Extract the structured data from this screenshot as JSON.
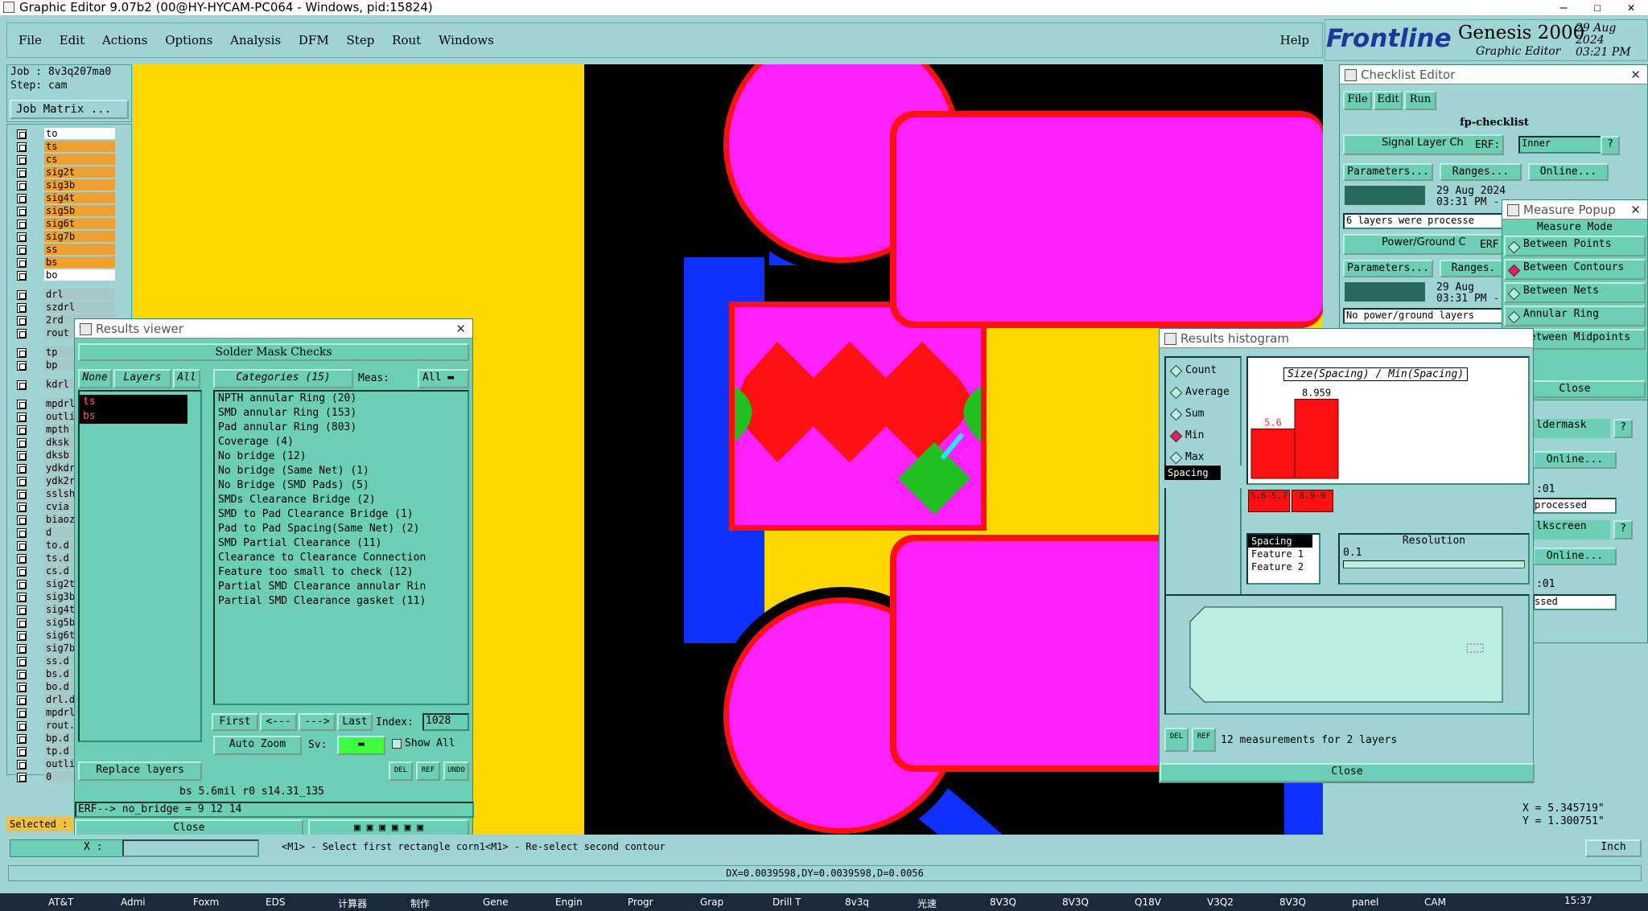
{
  "window": {
    "title": "Graphic Editor 9.07b2 (00@HY-HYCAM-PC064 - Windows, pid:15824)",
    "controls": [
      "—",
      "☐",
      "✕"
    ]
  },
  "menu": {
    "items": [
      "File",
      "Edit",
      "Actions",
      "Options",
      "Analysis",
      "DFM",
      "Step",
      "Rout",
      "Windows"
    ],
    "help": "Help"
  },
  "brand": {
    "logo": "Frontline",
    "product": "Genesis 2000",
    "subtitle": "Graphic Editor",
    "date": "29 Aug 2024",
    "time": "03:21 PM"
  },
  "job": {
    "job": "Job : 8v3q207ma0",
    "step": "Step: cam",
    "matrix": "Job Matrix ..."
  },
  "layers": [
    {
      "n": "to",
      "c": "#ffffff"
    },
    {
      "n": "ts",
      "c": "#f0a030"
    },
    {
      "n": "cs",
      "c": "#f0a030"
    },
    {
      "n": "sig2t",
      "c": "#f0a030"
    },
    {
      "n": "sig3b",
      "c": "#f0a030"
    },
    {
      "n": "sig4t",
      "c": "#f0a030"
    },
    {
      "n": "sig5b",
      "c": "#f0a030"
    },
    {
      "n": "sig6t",
      "c": "#f0a030"
    },
    {
      "n": "sig7b",
      "c": "#f0a030"
    },
    {
      "n": "ss",
      "c": "#f0a030"
    },
    {
      "n": "bs",
      "c": "#f0a030"
    },
    {
      "n": "bo",
      "c": "#ffffff"
    },
    {
      "n": "drl",
      "c": "#a8c8c8"
    },
    {
      "n": "szdrl",
      "c": "#a8c8c8"
    },
    {
      "n": "2rd",
      "c": "#a8c8c8"
    },
    {
      "n": "rout",
      "c": "#a8c8c8"
    },
    {
      "n": "tp",
      "c": "#a8c8c8"
    },
    {
      "n": "bp",
      "c": "#a8c8c8"
    },
    {
      "n": "kdrl",
      "c": "#a8c8c8"
    },
    {
      "n": "mpdrl",
      "c": "#a8c8c8"
    },
    {
      "n": "outlin",
      "c": "#a8c8c8"
    },
    {
      "n": "mpth",
      "c": "#a8c8c8"
    },
    {
      "n": "dksk",
      "c": "#a8c8c8"
    },
    {
      "n": "dksb",
      "c": "#a8c8c8"
    },
    {
      "n": "ydkdrl",
      "c": "#a8c8c8"
    },
    {
      "n": "ydk2rd",
      "c": "#a8c8c8"
    },
    {
      "n": "sslsh",
      "c": "#a8c8c8"
    },
    {
      "n": "cvia",
      "c": "#a8c8c8"
    },
    {
      "n": "biaozh",
      "c": "#a8c8c8"
    },
    {
      "n": "d",
      "c": "#a8c8c8"
    },
    {
      "n": "to.d",
      "c": "#a8c8c8"
    },
    {
      "n": "ts.d",
      "c": "#a8c8c8"
    },
    {
      "n": "cs.d",
      "c": "#a8c8c8"
    },
    {
      "n": "sig2t.",
      "c": "#a8c8c8"
    },
    {
      "n": "sig3b.",
      "c": "#a8c8c8"
    },
    {
      "n": "sig4t.",
      "c": "#a8c8c8"
    },
    {
      "n": "sig5b.",
      "c": "#a8c8c8"
    },
    {
      "n": "sig6t.",
      "c": "#a8c8c8"
    },
    {
      "n": "sig7b.",
      "c": "#a8c8c8"
    },
    {
      "n": "ss.d",
      "c": "#a8c8c8"
    },
    {
      "n": "bs.d",
      "c": "#a8c8c8"
    },
    {
      "n": "bo.d",
      "c": "#a8c8c8"
    },
    {
      "n": "drl.d",
      "c": "#a8c8c8"
    },
    {
      "n": "mpdrl.",
      "c": "#a8c8c8"
    },
    {
      "n": "rout.d",
      "c": "#a8c8c8"
    },
    {
      "n": "bp.d",
      "c": "#a8c8c8"
    },
    {
      "n": "tp.d",
      "c": "#a8c8c8"
    },
    {
      "n": "outlin",
      "c": "#a8c8c8"
    },
    {
      "n": "0",
      "c": "#a8c8c8"
    }
  ],
  "selected_label": "Selected :",
  "results_viewer": {
    "title": "Results viewer",
    "header": "Solder Mask Checks",
    "none": "None",
    "layers": "Layers",
    "all": "All",
    "categories": "Categories (15)",
    "meas": "Meas:",
    "meas_val": "All",
    "layer_items": [
      "ts",
      "bs"
    ],
    "cats": [
      "NPTH annular Ring (20)",
      "SMD annular Ring (153)",
      "Pad annular Ring (803)",
      "Coverage (4)",
      "No bridge (12)",
      "No bridge (Same Net) (1)",
      "No Bridge (SMD Pads) (5)",
      "SMDs Clearance Bridge (2)",
      "SMD to Pad Clearance Bridge (1)",
      "Pad to Pad Spacing(Same Net) (2)",
      "SMD Partial Clearance (11)",
      "Clearance to Clearance Connection",
      "Feature too small to check (12)",
      "Partial SMD Clearance annular Rin",
      "Partial SMD Clearance gasket (11)"
    ],
    "first": "First",
    "prev": "<---",
    "next": "--->",
    "last": "Last",
    "index_label": "Index:",
    "index_val": "1028",
    "autozoom": "Auto Zoom",
    "sv": "Sv:",
    "showall": "Show All",
    "replace": "Replace layers",
    "info": "bs 5.6mil  r0  s14.31_135",
    "erf": "ERF--> no_bridge = 9 12 14",
    "close": "Close",
    "del": "DEL",
    "ref": "REF",
    "undo": "UNDO"
  },
  "checklist": {
    "title": "Checklist Editor",
    "menus": [
      "File",
      "Edit",
      "Run"
    ],
    "name": "fp-checklist",
    "item1": "Signal Layer Ch",
    "erf": "ERF:",
    "erf_val": "Inner",
    "q": "?",
    "params": "Parameters...",
    "ranges": "Ranges...",
    "online": "Online...",
    "date1": "29 Aug 2024",
    "time1": "03:31 PM -",
    "msg1": "6 layers were processe",
    "item2": "Power/Ground C",
    "erf2": "ERF",
    "ranges2": "Ranges.",
    "date2": "29 Aug",
    "time2": "03:31 PM -",
    "msg2": "No power/ground layers",
    "soldermask": "ldermask",
    "online2": "Online...",
    "t01": ":01",
    "processed": "processed",
    "silkscreen": "lkscreen",
    "online3": "Online...",
    "t02": ":01",
    "ssed": "ssed"
  },
  "measure": {
    "title": "Measure Popup",
    "mode": "Measure Mode",
    "options": [
      "Between Points",
      "Between Contours",
      "Between Nets",
      "Annular Ring",
      "Between Midpoints"
    ],
    "selected": 1,
    "close": "Close"
  },
  "histogram": {
    "title": "Results histogram",
    "stats": [
      "Count",
      "Average",
      "Sum",
      "Min",
      "Max"
    ],
    "stat_selected": 3,
    "plot_title": "Size(Spacing) / Min(Spacing)",
    "list_item": "Spacing",
    "table": [
      "Spacing",
      "Feature 1",
      "Feature 2"
    ],
    "resolution_label": "Resolution",
    "resolution_val": "0.1",
    "summary": "12 measurements for 2 layers",
    "close": "Close",
    "del": "DEL",
    "ref": "REF"
  },
  "chart_data": {
    "type": "bar",
    "title": "Size(Spacing) / Min(Spacing)",
    "categories": [
      "5.6-5.7",
      "8.9-9"
    ],
    "values": [
      5.6,
      8.959
    ],
    "value_labels": [
      "5.6",
      "8.959"
    ],
    "ylim": [
      0,
      10
    ]
  },
  "status": {
    "prompt": "<M1> - Select first rectangle corn1<M1> - Re-select second contour",
    "dx": "DX=0.0039598,DY=0.0039598,D=0.0056",
    "x": "X = 5.345719\"",
    "y": "Y = 1.300751\"",
    "units": "Inch",
    "xfield": "X :"
  },
  "taskbar": {
    "items": [
      "AT&T",
      "Admi",
      "Foxm",
      "EDS",
      "计算器",
      "制作",
      "Gene",
      "Engin",
      "Progr",
      "Grap",
      "Drill T",
      "8v3q",
      "光速",
      "8V3Q",
      "8V3Q",
      "Q18V",
      "V3Q2",
      "8V3Q",
      "panel",
      "CAM"
    ],
    "clock": "15:37"
  }
}
